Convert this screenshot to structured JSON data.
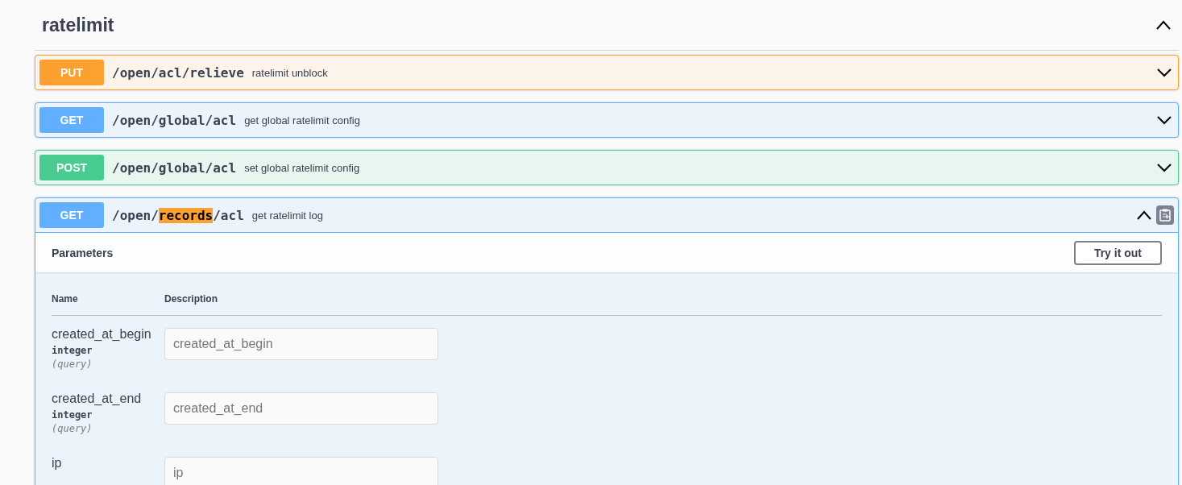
{
  "section": {
    "title": "ratelimit",
    "expanded": true
  },
  "operations": [
    {
      "method": "PUT",
      "path": [
        {
          "text": "/open/acl/relieve",
          "highlighted": false
        }
      ],
      "summary": "ratelimit unblock",
      "expanded": false
    },
    {
      "method": "GET",
      "path": [
        {
          "text": "/open/global/acl",
          "highlighted": false
        }
      ],
      "summary": "get global ratelimit config",
      "expanded": false
    },
    {
      "method": "POST",
      "path": [
        {
          "text": "/open/global/acl",
          "highlighted": false
        }
      ],
      "summary": "set global ratelimit config",
      "expanded": false
    },
    {
      "method": "GET",
      "path": [
        {
          "text": "/open/",
          "highlighted": false
        },
        {
          "text": "records",
          "highlighted": true
        },
        {
          "text": "/acl",
          "highlighted": false
        }
      ],
      "summary": "get ratelimit log",
      "expanded": true,
      "parameters": {
        "title": "Parameters",
        "try_button": "Try it out",
        "columns": [
          "Name",
          "Description"
        ],
        "rows": [
          {
            "name": "created_at_begin",
            "type": "integer",
            "location": "(query)",
            "placeholder": "created_at_begin"
          },
          {
            "name": "created_at_end",
            "type": "integer",
            "location": "(query)",
            "placeholder": "created_at_end"
          },
          {
            "name": "ip",
            "placeholder": "ip"
          }
        ]
      }
    }
  ]
}
